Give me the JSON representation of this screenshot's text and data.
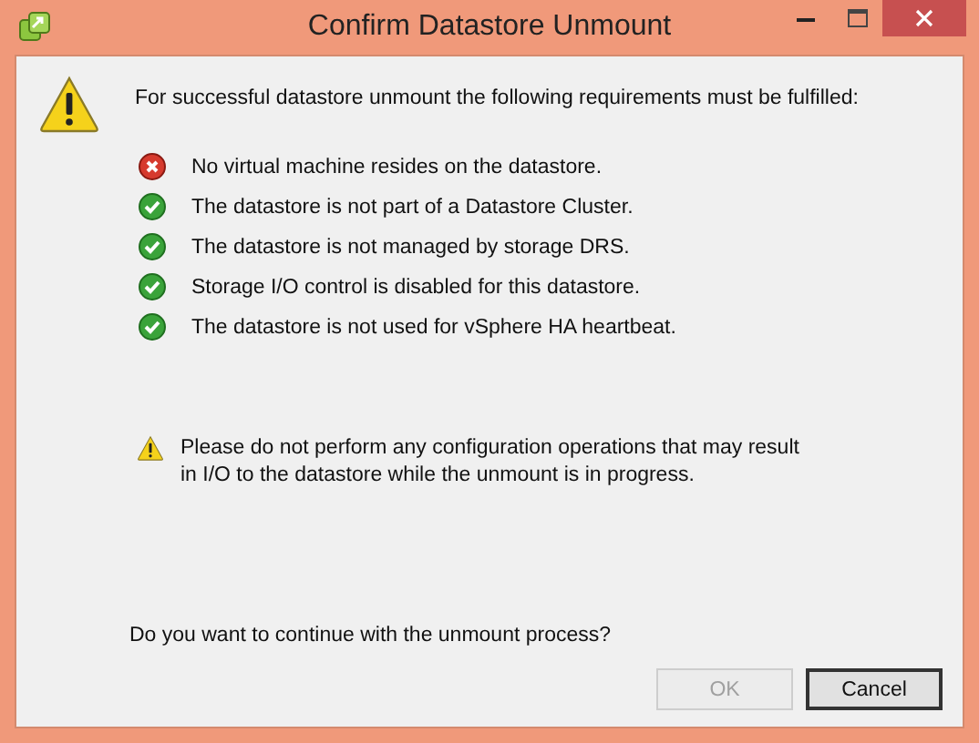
{
  "window": {
    "title": "Confirm Datastore Unmount"
  },
  "intro": "For successful datastore unmount the following requirements must be fulfilled:",
  "requirements": [
    {
      "text": "No virtual machine resides on the datastore.",
      "passed": false
    },
    {
      "text": "The datastore is not part of a Datastore Cluster.",
      "passed": true
    },
    {
      "text": "The datastore is not managed by storage DRS.",
      "passed": true
    },
    {
      "text": "Storage I/O control is disabled for this datastore.",
      "passed": true
    },
    {
      "text": "The datastore is not used for vSphere HA heartbeat.",
      "passed": true
    }
  ],
  "note": "Please do not perform any configuration operations that may result in I/O to the datastore while the unmount is in progress.",
  "question": "Do you want to continue with the unmount process?",
  "buttons": [
    {
      "label": "OK",
      "disabled": true
    },
    {
      "label": "Cancel",
      "disabled": false
    }
  ]
}
